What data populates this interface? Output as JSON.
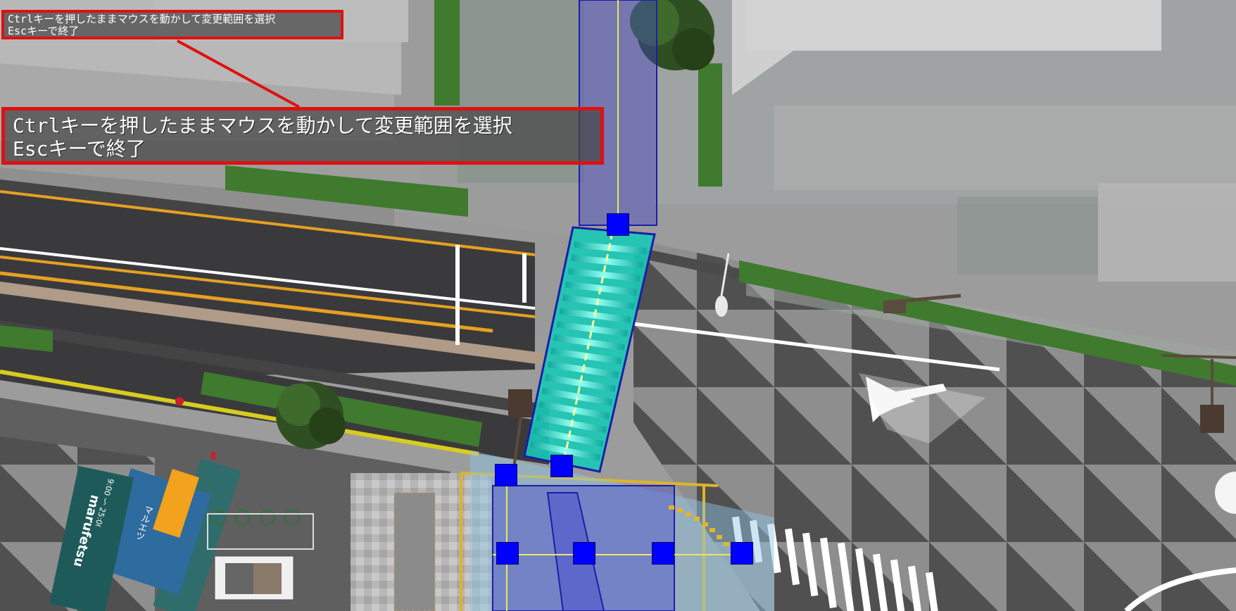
{
  "overlay_instructions": {
    "line1": "Ctrlキーを押したままマウスを動かして変更範囲を選択",
    "line2": "Escキーで終了"
  },
  "callout_zoom": {
    "line1": "Ctrlキーを押したままマウスを動かして変更範囲を選択",
    "line2": "Escキーで終了"
  },
  "signage": {
    "store_sign": "marufetsu",
    "sign_vertical": "マルエツ",
    "hours": "9:00 ～ 25:00"
  },
  "colors": {
    "callout_border": "#e01010",
    "handle": "#0000ff",
    "crosswalk_highlight": "#19e0c8",
    "selection_overlay": "#3c3cd2",
    "road_asphalt": "#3a3a3c",
    "center_line": "#e6a020",
    "hedge": "#3f7a2e"
  },
  "icons": [
    "tree-icon",
    "traffic-signal-icon",
    "street-lamp-icon",
    "road-arrow-icon",
    "control-handle-icon"
  ]
}
